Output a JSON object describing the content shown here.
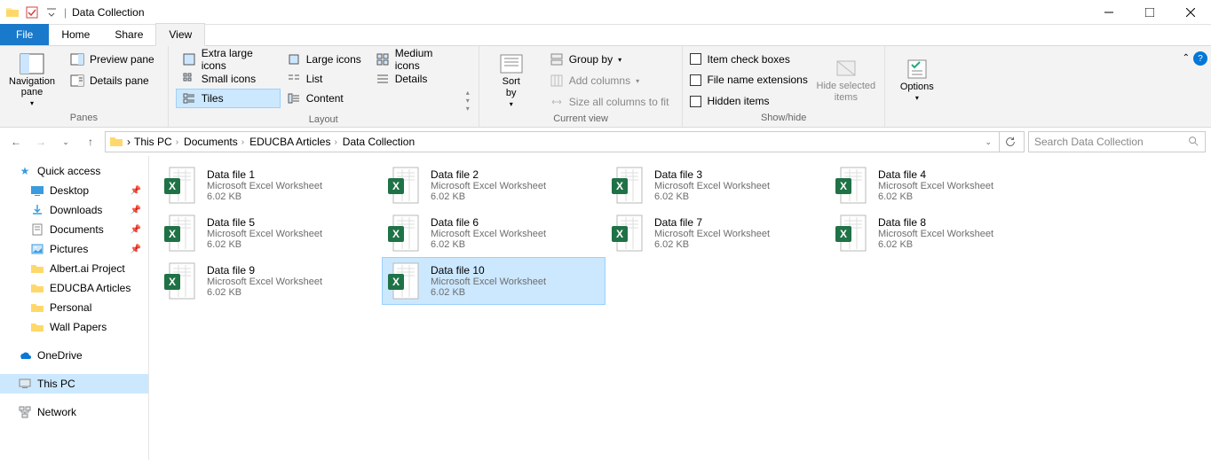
{
  "window": {
    "title": "Data Collection"
  },
  "tabs": {
    "file": "File",
    "home": "Home",
    "share": "Share",
    "view": "View"
  },
  "ribbon": {
    "panes": {
      "label": "Panes",
      "navpane": "Navigation\npane",
      "preview": "Preview pane",
      "details": "Details pane"
    },
    "layout": {
      "label": "Layout",
      "xlarge": "Extra large icons",
      "large": "Large icons",
      "medium": "Medium icons",
      "small": "Small icons",
      "list": "List",
      "details": "Details",
      "tiles": "Tiles",
      "content": "Content"
    },
    "currentview": {
      "label": "Current view",
      "sortby": "Sort\nby",
      "groupby": "Group by",
      "addcols": "Add columns",
      "sizecols": "Size all columns to fit"
    },
    "showhide": {
      "label": "Show/hide",
      "checkboxes": "Item check boxes",
      "ext": "File name extensions",
      "hidden": "Hidden items",
      "hidesel": "Hide selected\nitems"
    },
    "options": "Options"
  },
  "breadcrumb": [
    "This PC",
    "Documents",
    "EDUCBA Articles",
    "Data Collection"
  ],
  "search": {
    "placeholder": "Search Data Collection"
  },
  "sidebar": {
    "quickaccess": "Quick access",
    "desktop": "Desktop",
    "downloads": "Downloads",
    "documents": "Documents",
    "pictures": "Pictures",
    "albert": "Albert.ai Project",
    "educba": "EDUCBA Articles",
    "personal": "Personal",
    "wallpapers": "Wall Papers",
    "onedrive": "OneDrive",
    "thispc": "This PC",
    "network": "Network"
  },
  "files": [
    {
      "name": "Data file 1",
      "type": "Microsoft Excel Worksheet",
      "size": "6.02 KB"
    },
    {
      "name": "Data file 2",
      "type": "Microsoft Excel Worksheet",
      "size": "6.02 KB"
    },
    {
      "name": "Data file 3",
      "type": "Microsoft Excel Worksheet",
      "size": "6.02 KB"
    },
    {
      "name": "Data file 4",
      "type": "Microsoft Excel Worksheet",
      "size": "6.02 KB"
    },
    {
      "name": "Data file 5",
      "type": "Microsoft Excel Worksheet",
      "size": "6.02 KB"
    },
    {
      "name": "Data file 6",
      "type": "Microsoft Excel Worksheet",
      "size": "6.02 KB"
    },
    {
      "name": "Data file 7",
      "type": "Microsoft Excel Worksheet",
      "size": "6.02 KB"
    },
    {
      "name": "Data file 8",
      "type": "Microsoft Excel Worksheet",
      "size": "6.02 KB"
    },
    {
      "name": "Data file 9",
      "type": "Microsoft Excel Worksheet",
      "size": "6.02 KB"
    },
    {
      "name": "Data file 10",
      "type": "Microsoft Excel Worksheet",
      "size": "6.02 KB"
    }
  ],
  "selected_file_index": 9
}
